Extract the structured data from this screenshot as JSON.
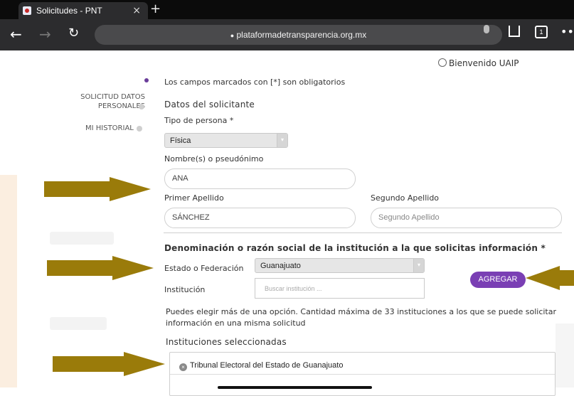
{
  "browser": {
    "tab_title": "Solicitudes - PNT",
    "tab_close": "×",
    "new_tab": "+",
    "url": "plataformadetransparencia.org.mx",
    "tabs_count": "1"
  },
  "header": {
    "welcome": "Bienvenido UAIP"
  },
  "sidebar": {
    "items": [
      {
        "label": "SOLICITUD DATOS PERSONALES"
      },
      {
        "label": "MI HISTORIAL"
      }
    ]
  },
  "form": {
    "required_note": "Los campos marcados con [*] son obligatorios",
    "section_solicitante": "Datos del solicitante",
    "tipo_persona_label": "Tipo de persona *",
    "tipo_persona_value": "Física",
    "nombre_label": "Nombre(s) o pseudónimo",
    "nombre_value": "ANA",
    "primer_apellido_label": "Primer Apellido",
    "primer_apellido_value": "SÁNCHEZ",
    "segundo_apellido_label": "Segundo Apellido",
    "segundo_apellido_placeholder": "Segundo Apellido",
    "section_institucion": "Denominación o razón social de la institución a la que solicitas información *",
    "estado_label": "Estado o Federación",
    "estado_value": "Guanajuato",
    "institucion_label": "Institución",
    "institucion_placeholder": "Buscar institución ...",
    "agregar_label": "AGREGAR",
    "help_text_1": "Puedes elegir más de una opción. Cantidad máxima de 33 instituciones a los que se puede solicitar",
    "help_text_2": "información en una misma solicitud",
    "selected_heading": "Instituciones seleccionadas",
    "selected_items": [
      {
        "label": "Tribunal Electoral del Estado de Guanajuato"
      }
    ]
  },
  "colors": {
    "accent": "#7a3fb4",
    "arrow": "#9a7b0a"
  },
  "icons": [
    "back-arrow-icon",
    "forward-arrow-icon",
    "reload-icon",
    "lock-icon",
    "mic-icon",
    "share-icon",
    "tabs-icon",
    "more-icon",
    "user-icon",
    "remove-icon"
  ]
}
